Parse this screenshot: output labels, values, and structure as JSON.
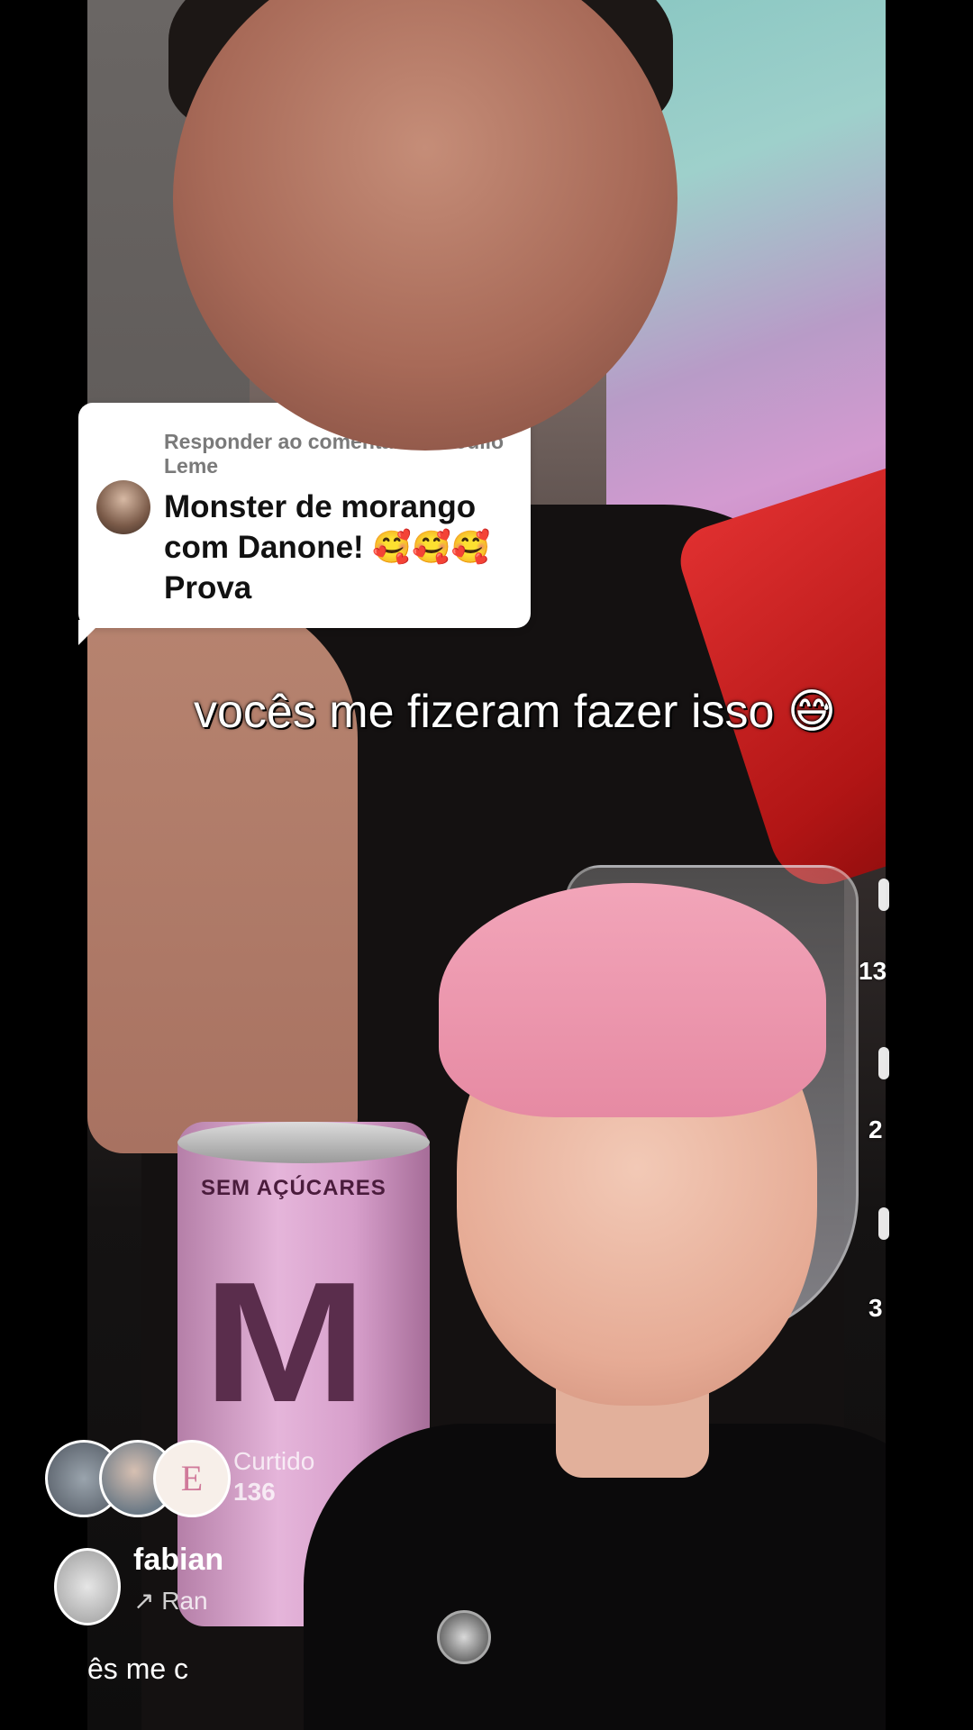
{
  "reply": {
    "header": "Responder ao comentário de Julio Leme",
    "comment": "Monster de morango com Danone! 🥰🥰🥰 Prova"
  },
  "video": {
    "caption": "vocês me fizeram fazer isso 😅",
    "can_label": "SEM AÇÚCARES",
    "can_logo": "M"
  },
  "side_stats": {
    "likes_partial": "13",
    "comments_partial": "2",
    "shares_partial": "3"
  },
  "embedded_post": {
    "avatar_letter": "E",
    "liked_label": "Curtido",
    "liked_count": "136",
    "username": "fabian",
    "repost_label": "↗ Ran",
    "caption_partial": "ês me c"
  },
  "colors": {
    "bubble_bg": "#ffffff",
    "caption_text": "#ffffff",
    "comment_text": "#111111",
    "header_text": "#7a7a7a"
  }
}
